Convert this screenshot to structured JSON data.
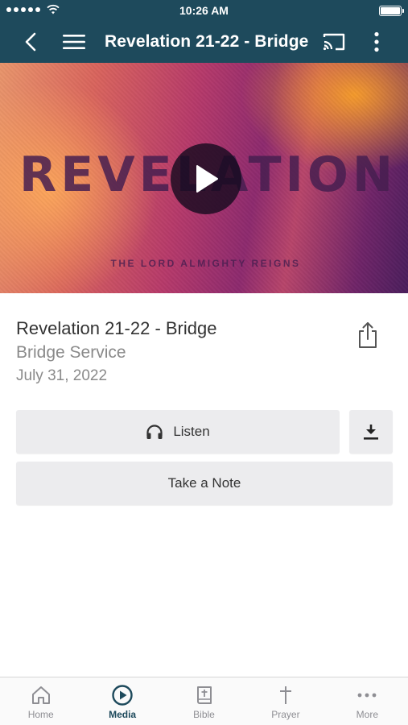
{
  "status_bar": {
    "time": "10:26 AM"
  },
  "nav": {
    "title": "Revelation 21-22 - Bridge"
  },
  "hero": {
    "series_title": "REVELATION",
    "tagline": "THE LORD ALMIGHTY REIGNS"
  },
  "sermon": {
    "title": "Revelation 21-22 - Bridge",
    "service": "Bridge Service",
    "date": "July 31, 2022"
  },
  "actions": {
    "listen_label": "Listen",
    "note_label": "Take a Note"
  },
  "tabs": [
    {
      "label": "Home",
      "icon": "home-icon"
    },
    {
      "label": "Media",
      "icon": "play-circle-icon",
      "active": true
    },
    {
      "label": "Bible",
      "icon": "bible-icon"
    },
    {
      "label": "Prayer",
      "icon": "cross-icon"
    },
    {
      "label": "More",
      "icon": "more-dots-icon"
    }
  ],
  "colors": {
    "header": "#1e4a5c",
    "active_tab": "#1e4a5c",
    "inactive_tab": "#8e8e93",
    "button_bg": "#ececee"
  }
}
